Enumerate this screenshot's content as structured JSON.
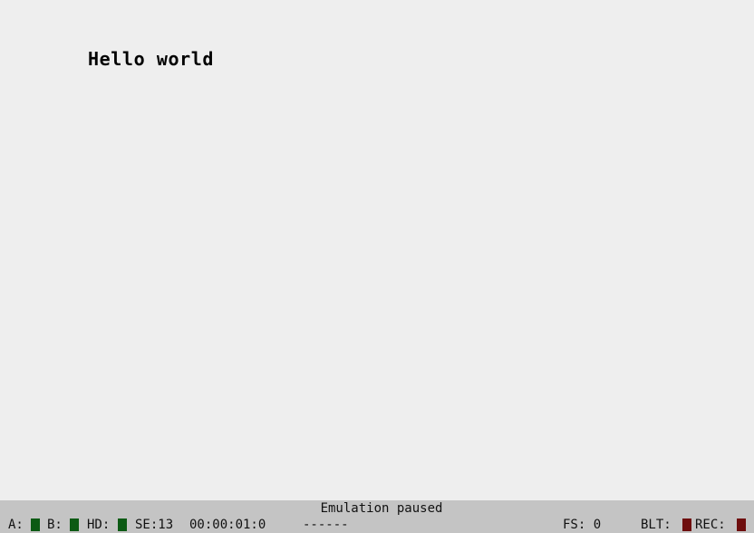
{
  "screen": {
    "text": "Hello world"
  },
  "status_bar": {
    "message": "Emulation paused",
    "drive_a_label": "A:",
    "drive_b_label": "B:",
    "hd_label": "HD:",
    "se_label": "SE:13",
    "timecode": "00:00:01:0",
    "track_info": "------",
    "fs_label": "FS: 0",
    "blt_label": "BLT:",
    "rec_label": "REC:",
    "colors": {
      "drive_led": "#0c5a14",
      "blt_led": "#6e0e0e",
      "rec_led": "#6e0e0e",
      "bar_bg": "#c4c4c4",
      "screen_bg": "#eeeeee"
    }
  }
}
